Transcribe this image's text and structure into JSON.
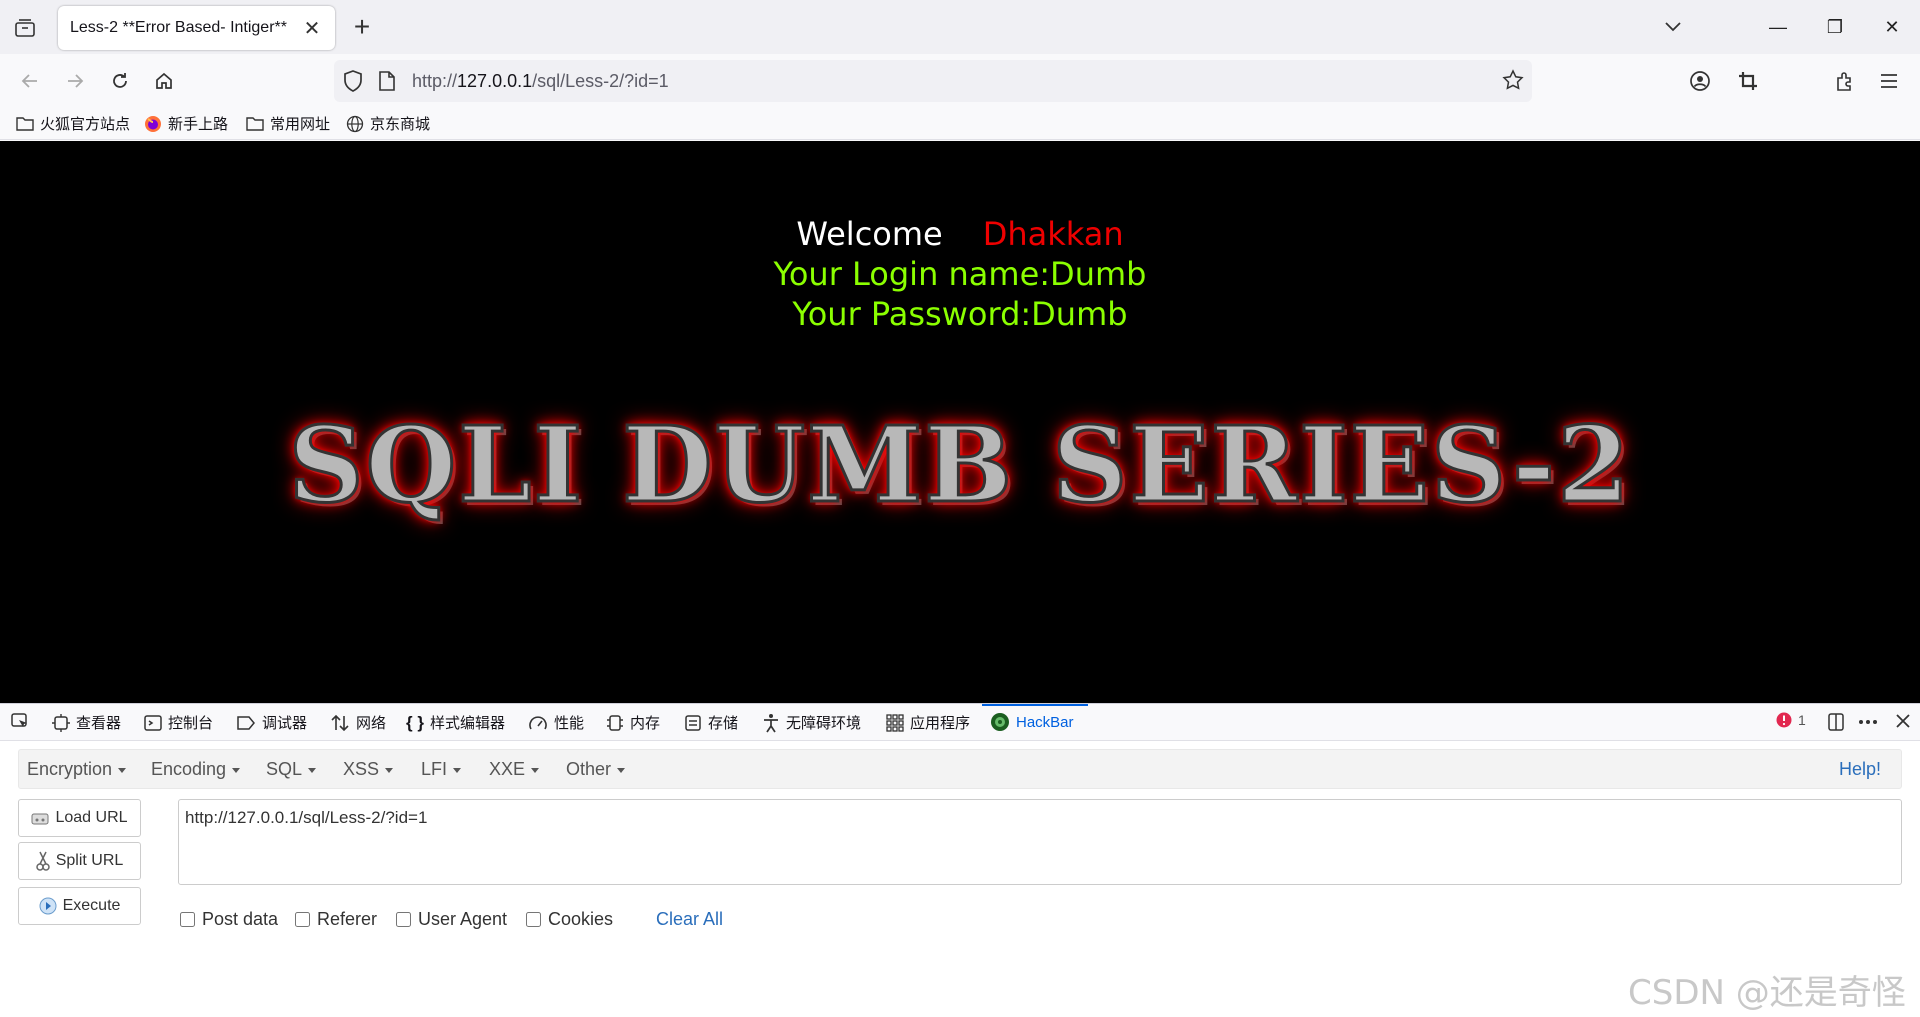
{
  "tab": {
    "title": "Less-2 **Error Based- Intiger**",
    "close": "✕",
    "new": "+"
  },
  "window": {
    "minimize": "—",
    "restore": "❐",
    "close": "✕"
  },
  "url": {
    "prefix": "http://",
    "host": "127.0.0.1",
    "path": "/sql/Less-2/?id=1"
  },
  "bookmarks": [
    "火狐官方站点",
    "新手上路",
    "常用网址",
    "京东商城"
  ],
  "page": {
    "welcome": "Welcome",
    "name": "Dhakkan",
    "login": "Your Login name:Dumb",
    "password": "Your Password:Dumb",
    "banner": "SQLI DUMB SERIES-2"
  },
  "devtools": {
    "tabs": [
      "查看器",
      "控制台",
      "调试器",
      "网络",
      "样式编辑器",
      "性能",
      "内存",
      "存储",
      "无障碍环境",
      "应用程序",
      "HackBar"
    ],
    "error_count": "1"
  },
  "hackbar": {
    "menu": [
      "Encryption",
      "Encoding",
      "SQL",
      "XSS",
      "LFI",
      "XXE",
      "Other"
    ],
    "help": "Help!",
    "buttons": {
      "load": "Load URL",
      "split": "Split URL",
      "execute": "Execute"
    },
    "url_value": "http://127.0.0.1/sql/Less-2/?id=1",
    "checks": [
      "Post data",
      "Referer",
      "User Agent",
      "Cookies"
    ],
    "clear": "Clear All"
  },
  "watermark": "CSDN @还是奇怪",
  "colors": {
    "welcome_name": "#ee0000",
    "login_text": "#8bff00",
    "accent": "#0061e0"
  }
}
